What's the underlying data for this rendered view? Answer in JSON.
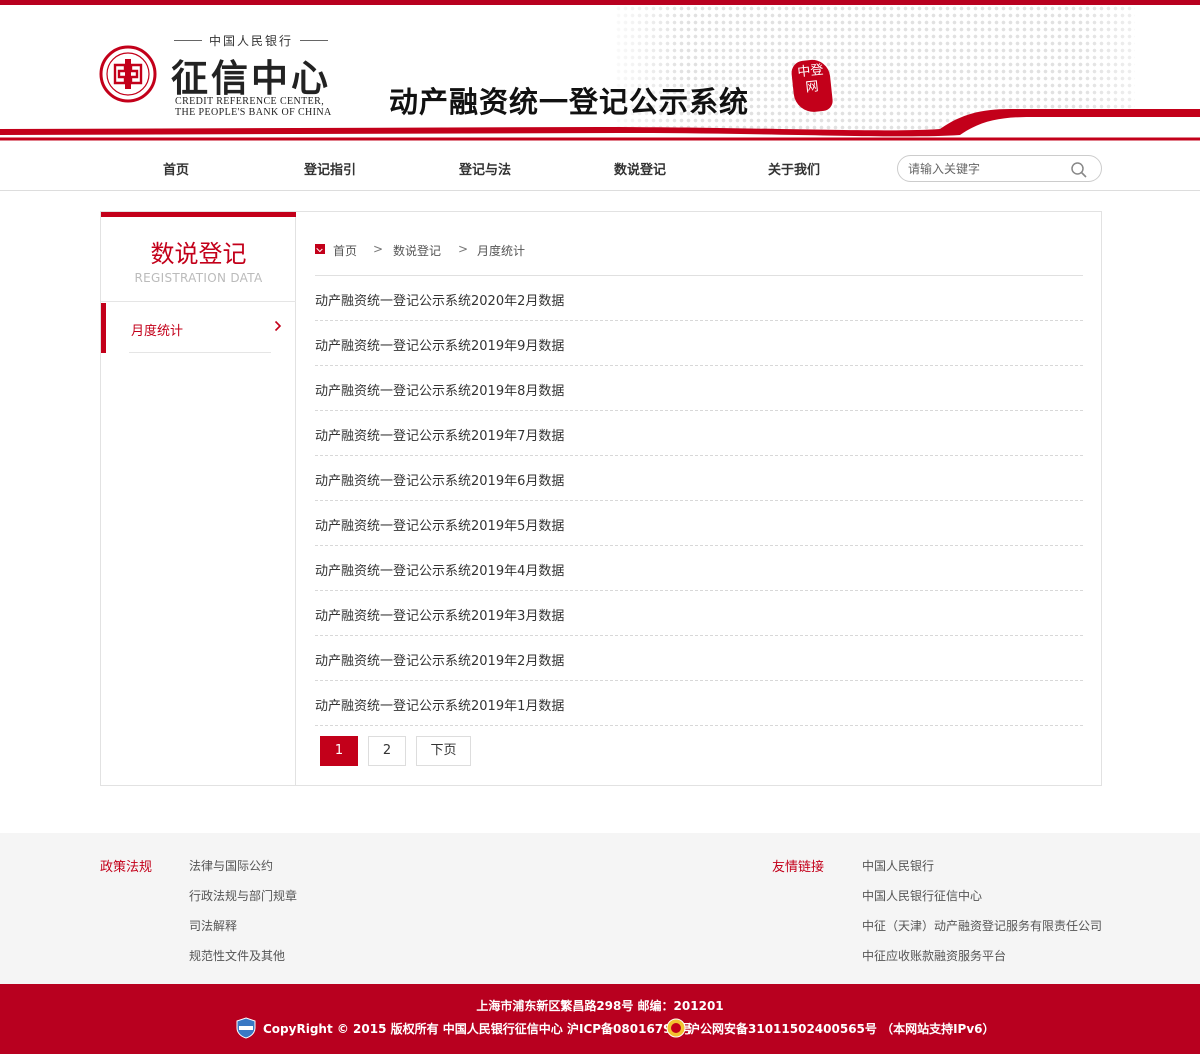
{
  "header": {
    "logo_top": "中国人民银行",
    "logo_main": "征信中心",
    "logo_en_line1": "CREDIT REFERENCE CENTER,",
    "logo_en_line2": "THE PEOPLE'S BANK OF CHINA",
    "system_title": "动产融资统一登记公示系统",
    "seal_text": "中登网",
    "icons": [
      "pbc-logo-icon",
      "seal-icon"
    ],
    "colors": {
      "brand": "#c3001a",
      "topbar": "#b8001f"
    }
  },
  "nav": {
    "items": [
      "首页",
      "登记指引",
      "登记与法",
      "数说登记",
      "关于我们"
    ],
    "search_placeholder": "请输入关键字"
  },
  "sidebar": {
    "title": "数说登记",
    "subtitle": "REGISTRATION DATA",
    "items": [
      {
        "label": "月度统计",
        "active": true
      }
    ]
  },
  "breadcrumb": [
    "首页",
    "数说登记",
    "月度统计"
  ],
  "list": {
    "items": [
      "动产融资统一登记公示系统2020年2月数据",
      "动产融资统一登记公示系统2019年9月数据",
      "动产融资统一登记公示系统2019年8月数据",
      "动产融资统一登记公示系统2019年7月数据",
      "动产融资统一登记公示系统2019年6月数据",
      "动产融资统一登记公示系统2019年5月数据",
      "动产融资统一登记公示系统2019年4月数据",
      "动产融资统一登记公示系统2019年3月数据",
      "动产融资统一登记公示系统2019年2月数据",
      "动产融资统一登记公示系统2019年1月数据"
    ]
  },
  "pagination": {
    "pages": [
      "1",
      "2"
    ],
    "current": "1",
    "next_label": "下页"
  },
  "footer": {
    "policy_heading": "政策法规",
    "policy_links": [
      "法律与国际公约",
      "行政法规与部门规章",
      "司法解释",
      "规范性文件及其他"
    ],
    "friends_heading": "友情链接",
    "friends_links": [
      "中国人民银行",
      "中国人民银行征信中心",
      "中征（天津）动产融资登记服务有限责任公司",
      "中征应收账款融资服务平台"
    ],
    "address": "上海市浦东新区繁昌路298号 邮编：201201",
    "copyright": "CopyRight © 2015 版权所有 中国人民银行征信中心 沪ICP备08016794号",
    "police": "沪公网安备31011502400565号 （本网站支持IPv6）"
  }
}
